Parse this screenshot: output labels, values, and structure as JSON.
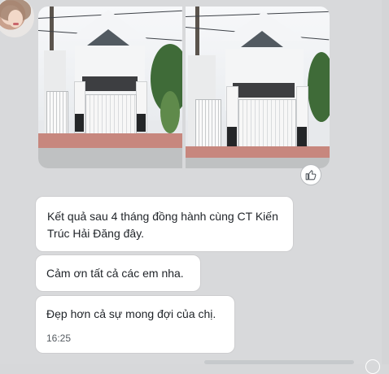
{
  "messages": [
    {
      "text": "Kết quả sau 4 tháng đồng hành cùng CT Kiến Trúc Hải Đăng đây."
    },
    {
      "text": "Cảm ơn tất cả các em nha."
    },
    {
      "text": "Đẹp hơn cả sự mong đợi của chị.",
      "time": "16:25"
    }
  ],
  "icons": {
    "avatar": "user-avatar",
    "like": "thumbs-up-icon"
  },
  "colors": {
    "background": "#d8d9db",
    "bubble": "#ffffff",
    "text": "#1f2328",
    "time": "#555b61"
  }
}
